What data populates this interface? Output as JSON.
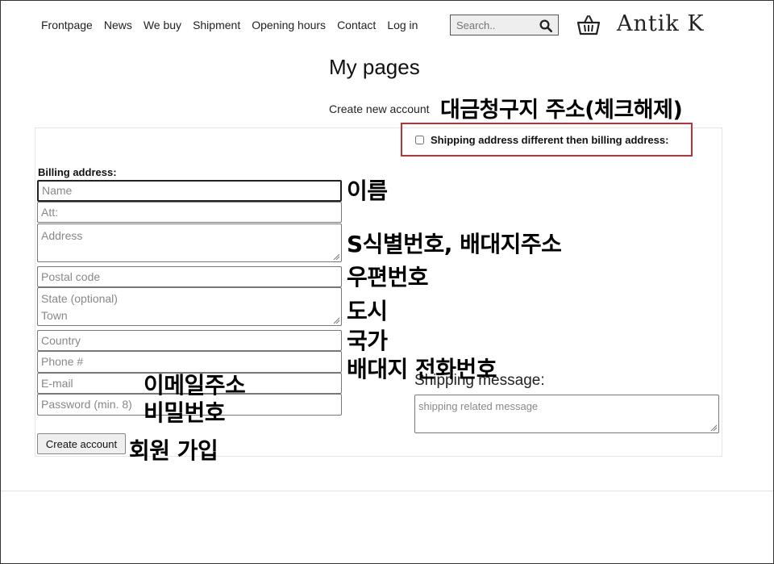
{
  "nav": [
    "Frontpage",
    "News",
    "We buy",
    "Shipment",
    "Opening hours",
    "Contact",
    "Log in"
  ],
  "search": {
    "placeholder": "Search.."
  },
  "brand": "Antik K",
  "page_title": "My pages",
  "create_link": "Create new account",
  "shipping_toggle_label": "Shipping address different then billing address:",
  "billing_label": "Billing address:",
  "fields": {
    "name": "Name",
    "att": "Att:",
    "address": "Address",
    "postal": "Postal code",
    "state_town": "State (optional)\nTown",
    "country": "Country",
    "phone": "Phone #",
    "email": "E-mail",
    "password": "Password (min. 8)"
  },
  "shipping_message": {
    "label": "Shipping message:",
    "placeholder": "shipping related message"
  },
  "create_button": "Create account",
  "annotations": {
    "billing_uncheck": "대금청구지 주소(체크해제)",
    "name": "이름",
    "address": "S식별번호, 배대지주소",
    "postal": "우편번호",
    "city": "도시",
    "country": "국가",
    "phone": "배대지 전화번호",
    "email": "이메일주소",
    "password": "비밀번호",
    "signup": "회원 가입"
  },
  "colors": {
    "highlight_border": "#b8323a"
  }
}
